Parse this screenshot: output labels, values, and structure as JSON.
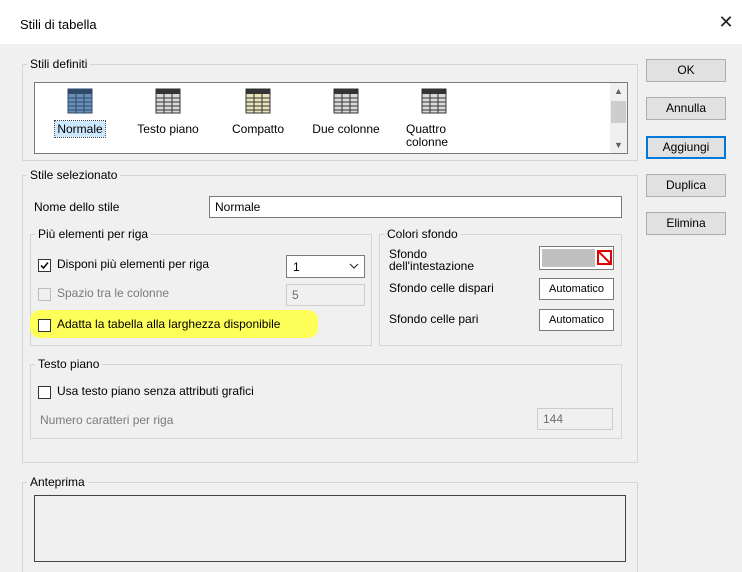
{
  "window": {
    "title": "Stili di tabella",
    "close_glyph": "✕"
  },
  "styles_group": {
    "legend": "Stili definiti",
    "items": [
      {
        "label": "Normale",
        "icon": "table-grid-icon",
        "selected": true
      },
      {
        "label": "Testo piano",
        "icon": "table-grid-icon",
        "selected": false
      },
      {
        "label": "Compatto",
        "icon": "table-grid-icon",
        "selected": false
      },
      {
        "label": "Due colonne",
        "icon": "table-grid-icon",
        "selected": false
      },
      {
        "label": "Quattro colonne",
        "icon": "table-grid-icon",
        "selected": false
      }
    ]
  },
  "buttons": {
    "ok": "OK",
    "cancel": "Annulla",
    "add": "Aggiungi",
    "duplicate": "Duplica",
    "delete": "Elimina"
  },
  "selected_style": {
    "legend": "Stile selezionato",
    "name_label": "Nome dello stile",
    "name_value": "Normale",
    "multi_group": {
      "legend": "Più elementi per riga",
      "arrange_label": "Disponi più elementi per riga",
      "arrange_checked": true,
      "arrange_count": "1",
      "spacing_label": "Spazio tra le colonne",
      "spacing_value": "5",
      "fit_label": "Adatta la tabella alla larghezza disponibile",
      "fit_checked": false
    },
    "colors_group": {
      "legend": "Colori sfondo",
      "header_label": "Sfondo dell'intestazione",
      "odd_label": "Sfondo celle dispari",
      "odd_value": "Automatico",
      "even_label": "Sfondo celle pari",
      "even_value": "Automatico",
      "header_swatch_color": "#c0c0c0"
    },
    "plain_group": {
      "legend": "Testo piano",
      "use_label": "Usa testo piano senza attributi grafici",
      "use_checked": false,
      "chars_label": "Numero caratteri per riga",
      "chars_value": "144"
    }
  },
  "preview": {
    "legend": "Anteprima"
  },
  "colors": {
    "highlight": "#ffff5a",
    "focus_blue": "#0078d7",
    "selection_bg": "#cce8ff",
    "no_color_red": "#e00000"
  }
}
